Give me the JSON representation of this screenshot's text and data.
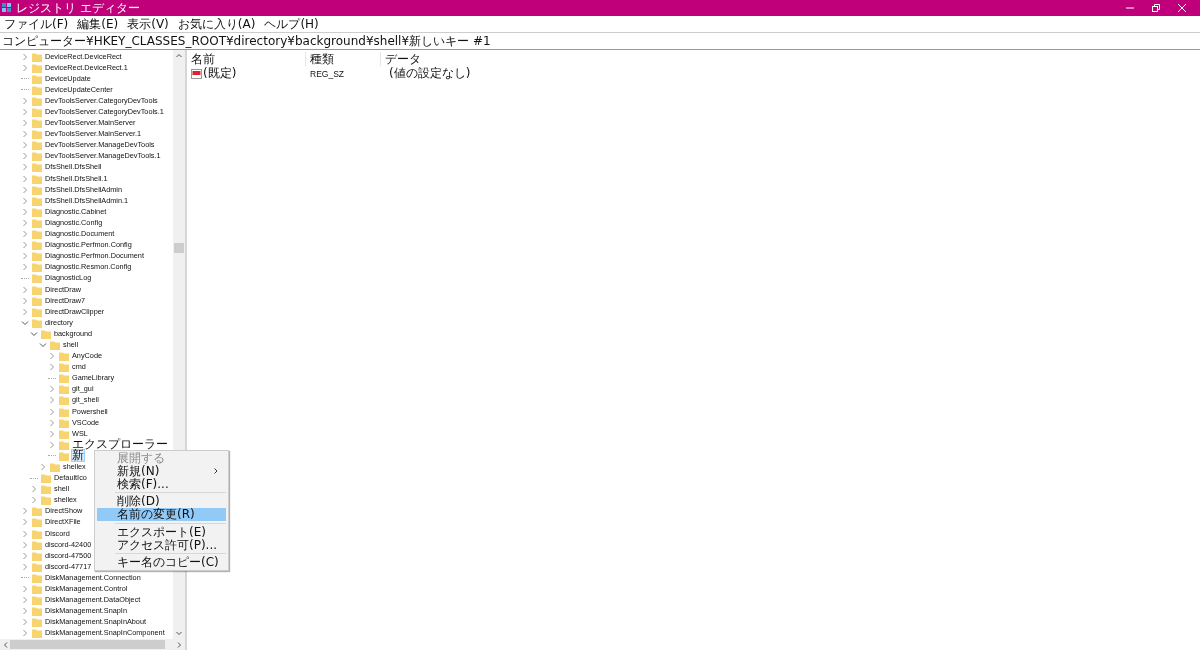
{
  "window": {
    "title": "レジストリ エディター"
  },
  "menu": [
    "ファイル(F)",
    "編集(E)",
    "表示(V)",
    "お気に入り(A)",
    "ヘルプ(H)"
  ],
  "address": "コンピューター¥HKEY_CLASSES_ROOT¥directory¥background¥shell¥新しいキー #1",
  "tree": [
    {
      "label": "DeviceRect.DeviceRect",
      "kind": "branch",
      "expanded": false,
      "selected": false
    },
    {
      "label": "DeviceRect.DeviceRect.1",
      "kind": "branch",
      "expanded": false,
      "selected": false
    },
    {
      "label": "DeviceUpdate",
      "kind": "leaf",
      "selected": false
    },
    {
      "label": "DeviceUpdateCenter",
      "kind": "leaf",
      "selected": false
    },
    {
      "label": "DevToolsServer.CategoryDevTools",
      "kind": "branch",
      "expanded": false,
      "selected": false
    },
    {
      "label": "DevToolsServer.CategoryDevTools.1",
      "kind": "branch",
      "expanded": false,
      "selected": false
    },
    {
      "label": "DevToolsServer.MainServer",
      "kind": "branch",
      "expanded": false,
      "selected": false
    },
    {
      "label": "DevToolsServer.MainServer.1",
      "kind": "branch",
      "expanded": false,
      "selected": false
    },
    {
      "label": "DevToolsServer.ManageDevTools",
      "kind": "branch",
      "expanded": false,
      "selected": false
    },
    {
      "label": "DevToolsServer.ManageDevTools.1",
      "kind": "branch",
      "expanded": false,
      "selected": false
    },
    {
      "label": "DfsShell.DfsShell",
      "kind": "branch",
      "expanded": false,
      "selected": false
    },
    {
      "label": "DfsShell.DfsShell.1",
      "kind": "branch",
      "expanded": false,
      "selected": false
    },
    {
      "label": "DfsShell.DfsShellAdmin",
      "kind": "branch",
      "expanded": false,
      "selected": false
    },
    {
      "label": "DfsShell.DfsShellAdmin.1",
      "kind": "branch",
      "expanded": false,
      "selected": false
    },
    {
      "label": "Diagnostic.Cabinet",
      "kind": "branch",
      "expanded": false,
      "selected": false
    },
    {
      "label": "Diagnostic.Config",
      "kind": "branch",
      "expanded": false,
      "selected": false
    },
    {
      "label": "Diagnostic.Document",
      "kind": "branch",
      "expanded": false,
      "selected": false
    },
    {
      "label": "Diagnostic.Perfmon.Config",
      "kind": "branch",
      "expanded": false,
      "selected": false
    },
    {
      "label": "Diagnostic.Perfmon.Document",
      "kind": "branch",
      "expanded": false,
      "selected": false
    },
    {
      "label": "Diagnostic.Resmon.Config",
      "kind": "branch",
      "expanded": false,
      "selected": false
    },
    {
      "label": "DiagnosticLog",
      "kind": "leaf",
      "selected": false
    },
    {
      "label": "DirectDraw",
      "kind": "branch",
      "expanded": false,
      "selected": false
    },
    {
      "label": "DirectDraw7",
      "kind": "branch",
      "expanded": false,
      "selected": false
    },
    {
      "label": "DirectDrawClipper",
      "kind": "branch",
      "expanded": false,
      "selected": false
    },
    {
      "label": "directory",
      "kind": "branch",
      "expanded": true,
      "selected": false,
      "children": [
        {
          "label": "background",
          "kind": "branch",
          "expanded": true,
          "selected": false,
          "children": [
            {
              "label": "shell",
              "kind": "branch",
              "expanded": true,
              "selected": false,
              "children": [
                {
                  "label": "AnyCode",
                  "kind": "branch",
                  "expanded": false,
                  "selected": false
                },
                {
                  "label": "cmd",
                  "kind": "branch",
                  "expanded": false,
                  "selected": false
                },
                {
                  "label": "GameLibrary",
                  "kind": "leaf",
                  "selected": false
                },
                {
                  "label": "git_gui",
                  "kind": "branch",
                  "expanded": false,
                  "selected": false
                },
                {
                  "label": "git_shell",
                  "kind": "branch",
                  "expanded": false,
                  "selected": false
                },
                {
                  "label": "Powershell",
                  "kind": "branch",
                  "expanded": false,
                  "selected": false
                },
                {
                  "label": "VSCode",
                  "kind": "branch",
                  "expanded": false,
                  "selected": false
                },
                {
                  "label": "WSL",
                  "kind": "branch",
                  "expanded": false,
                  "selected": false
                },
                {
                  "label": "エクスプローラー",
                  "kind": "branch",
                  "expanded": false,
                  "selected": false
                },
                {
                  "label": "新",
                  "kind": "leaf",
                  "selected": true
                }
              ]
            },
            {
              "label": "shellex",
              "kind": "branch",
              "expanded": false,
              "selected": false
            }
          ]
        },
        {
          "label": "DefaultIco",
          "kind": "leaf",
          "selected": false
        },
        {
          "label": "shell",
          "kind": "branch",
          "expanded": false,
          "selected": false
        },
        {
          "label": "shellex",
          "kind": "branch",
          "expanded": false,
          "selected": false
        }
      ]
    },
    {
      "label": "DirectShow",
      "kind": "branch",
      "expanded": false,
      "selected": false
    },
    {
      "label": "DirectXFile",
      "kind": "branch",
      "expanded": false,
      "selected": false
    },
    {
      "label": "Discord",
      "kind": "branch",
      "expanded": false,
      "selected": false
    },
    {
      "label": "discord-42400",
      "kind": "branch",
      "expanded": false,
      "selected": false
    },
    {
      "label": "discord-47500",
      "kind": "branch",
      "expanded": false,
      "selected": false
    },
    {
      "label": "discord-47717",
      "kind": "branch",
      "expanded": false,
      "selected": false
    },
    {
      "label": "DiskManagement.Connection",
      "kind": "leaf",
      "selected": false
    },
    {
      "label": "DiskManagement.Control",
      "kind": "branch",
      "expanded": false,
      "selected": false
    },
    {
      "label": "DiskManagement.DataObject",
      "kind": "branch",
      "expanded": false,
      "selected": false
    },
    {
      "label": "DiskManagement.SnapIn",
      "kind": "branch",
      "expanded": false,
      "selected": false
    },
    {
      "label": "DiskManagement.SnapInAbout",
      "kind": "branch",
      "expanded": false,
      "selected": false
    },
    {
      "label": "DiskManagement.SnapInComponent",
      "kind": "branch",
      "expanded": false,
      "selected": false
    }
  ],
  "values": {
    "columns": [
      "名前",
      "種類",
      "データ"
    ],
    "rows": [
      {
        "name": "(既定)",
        "type": "REG_SZ",
        "data": "(値の設定なし)"
      }
    ]
  },
  "context_menu": [
    {
      "kind": "item",
      "label": "展開する",
      "disabled": true,
      "submenu": false,
      "selected": false
    },
    {
      "kind": "item",
      "label": "新規(N)",
      "disabled": false,
      "submenu": true,
      "selected": false
    },
    {
      "kind": "item",
      "label": "検索(F)...",
      "disabled": false,
      "submenu": false,
      "selected": false
    },
    {
      "kind": "separator"
    },
    {
      "kind": "item",
      "label": "削除(D)",
      "disabled": false,
      "submenu": false,
      "selected": false
    },
    {
      "kind": "item",
      "label": "名前の変更(R)",
      "disabled": false,
      "submenu": false,
      "selected": true
    },
    {
      "kind": "separator"
    },
    {
      "kind": "item",
      "label": "エクスポート(E)",
      "disabled": false,
      "submenu": false,
      "selected": false
    },
    {
      "kind": "item",
      "label": "アクセス許可(P)...",
      "disabled": false,
      "submenu": false,
      "selected": false
    },
    {
      "kind": "separator"
    },
    {
      "kind": "item",
      "label": "キー名のコピー(C)",
      "disabled": false,
      "submenu": false,
      "selected": false
    }
  ]
}
